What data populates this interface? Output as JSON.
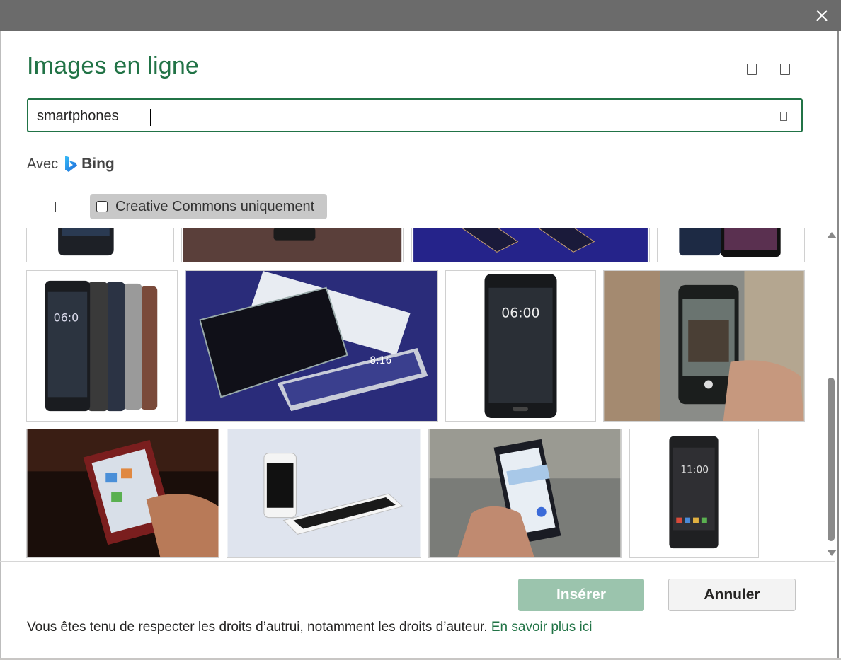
{
  "dialog": {
    "title": "Images en ligne",
    "close_icon": "close-icon"
  },
  "search": {
    "value": "smartphones",
    "icon": "search-icon"
  },
  "provider": {
    "prefix": "Avec",
    "name": "Bing",
    "logo": "bing-logo-icon"
  },
  "filters": {
    "filter_icon": "filter-icon",
    "creative_commons_label": "Creative Commons uniquement",
    "creative_commons_checked": false
  },
  "results": {
    "rows": [
      {
        "items": [
          "nokia-phone-partial",
          "hand-phone-dark-partial",
          "blue-phones-partial",
          "huawei-phone-partial"
        ]
      },
      {
        "items": [
          "nokia-lineup",
          "xiaomi-phones-blue",
          "nokia-single-black",
          "hand-photo-street"
        ]
      },
      {
        "items": [
          "hand-phone-red",
          "iphone-white-lying",
          "hand-phone-maps",
          "blackberry-phone"
        ]
      }
    ]
  },
  "footer": {
    "insert_label": "Insérer",
    "cancel_label": "Annuler",
    "notice": "Vous êtes tenu de respecter les droits d’autrui, notamment les droits d’auteur.",
    "learn_more": "En savoir plus ici"
  },
  "colors": {
    "accent": "#217346",
    "insert_disabled": "#9bc4ad",
    "titlebar": "#6b6b6b"
  }
}
